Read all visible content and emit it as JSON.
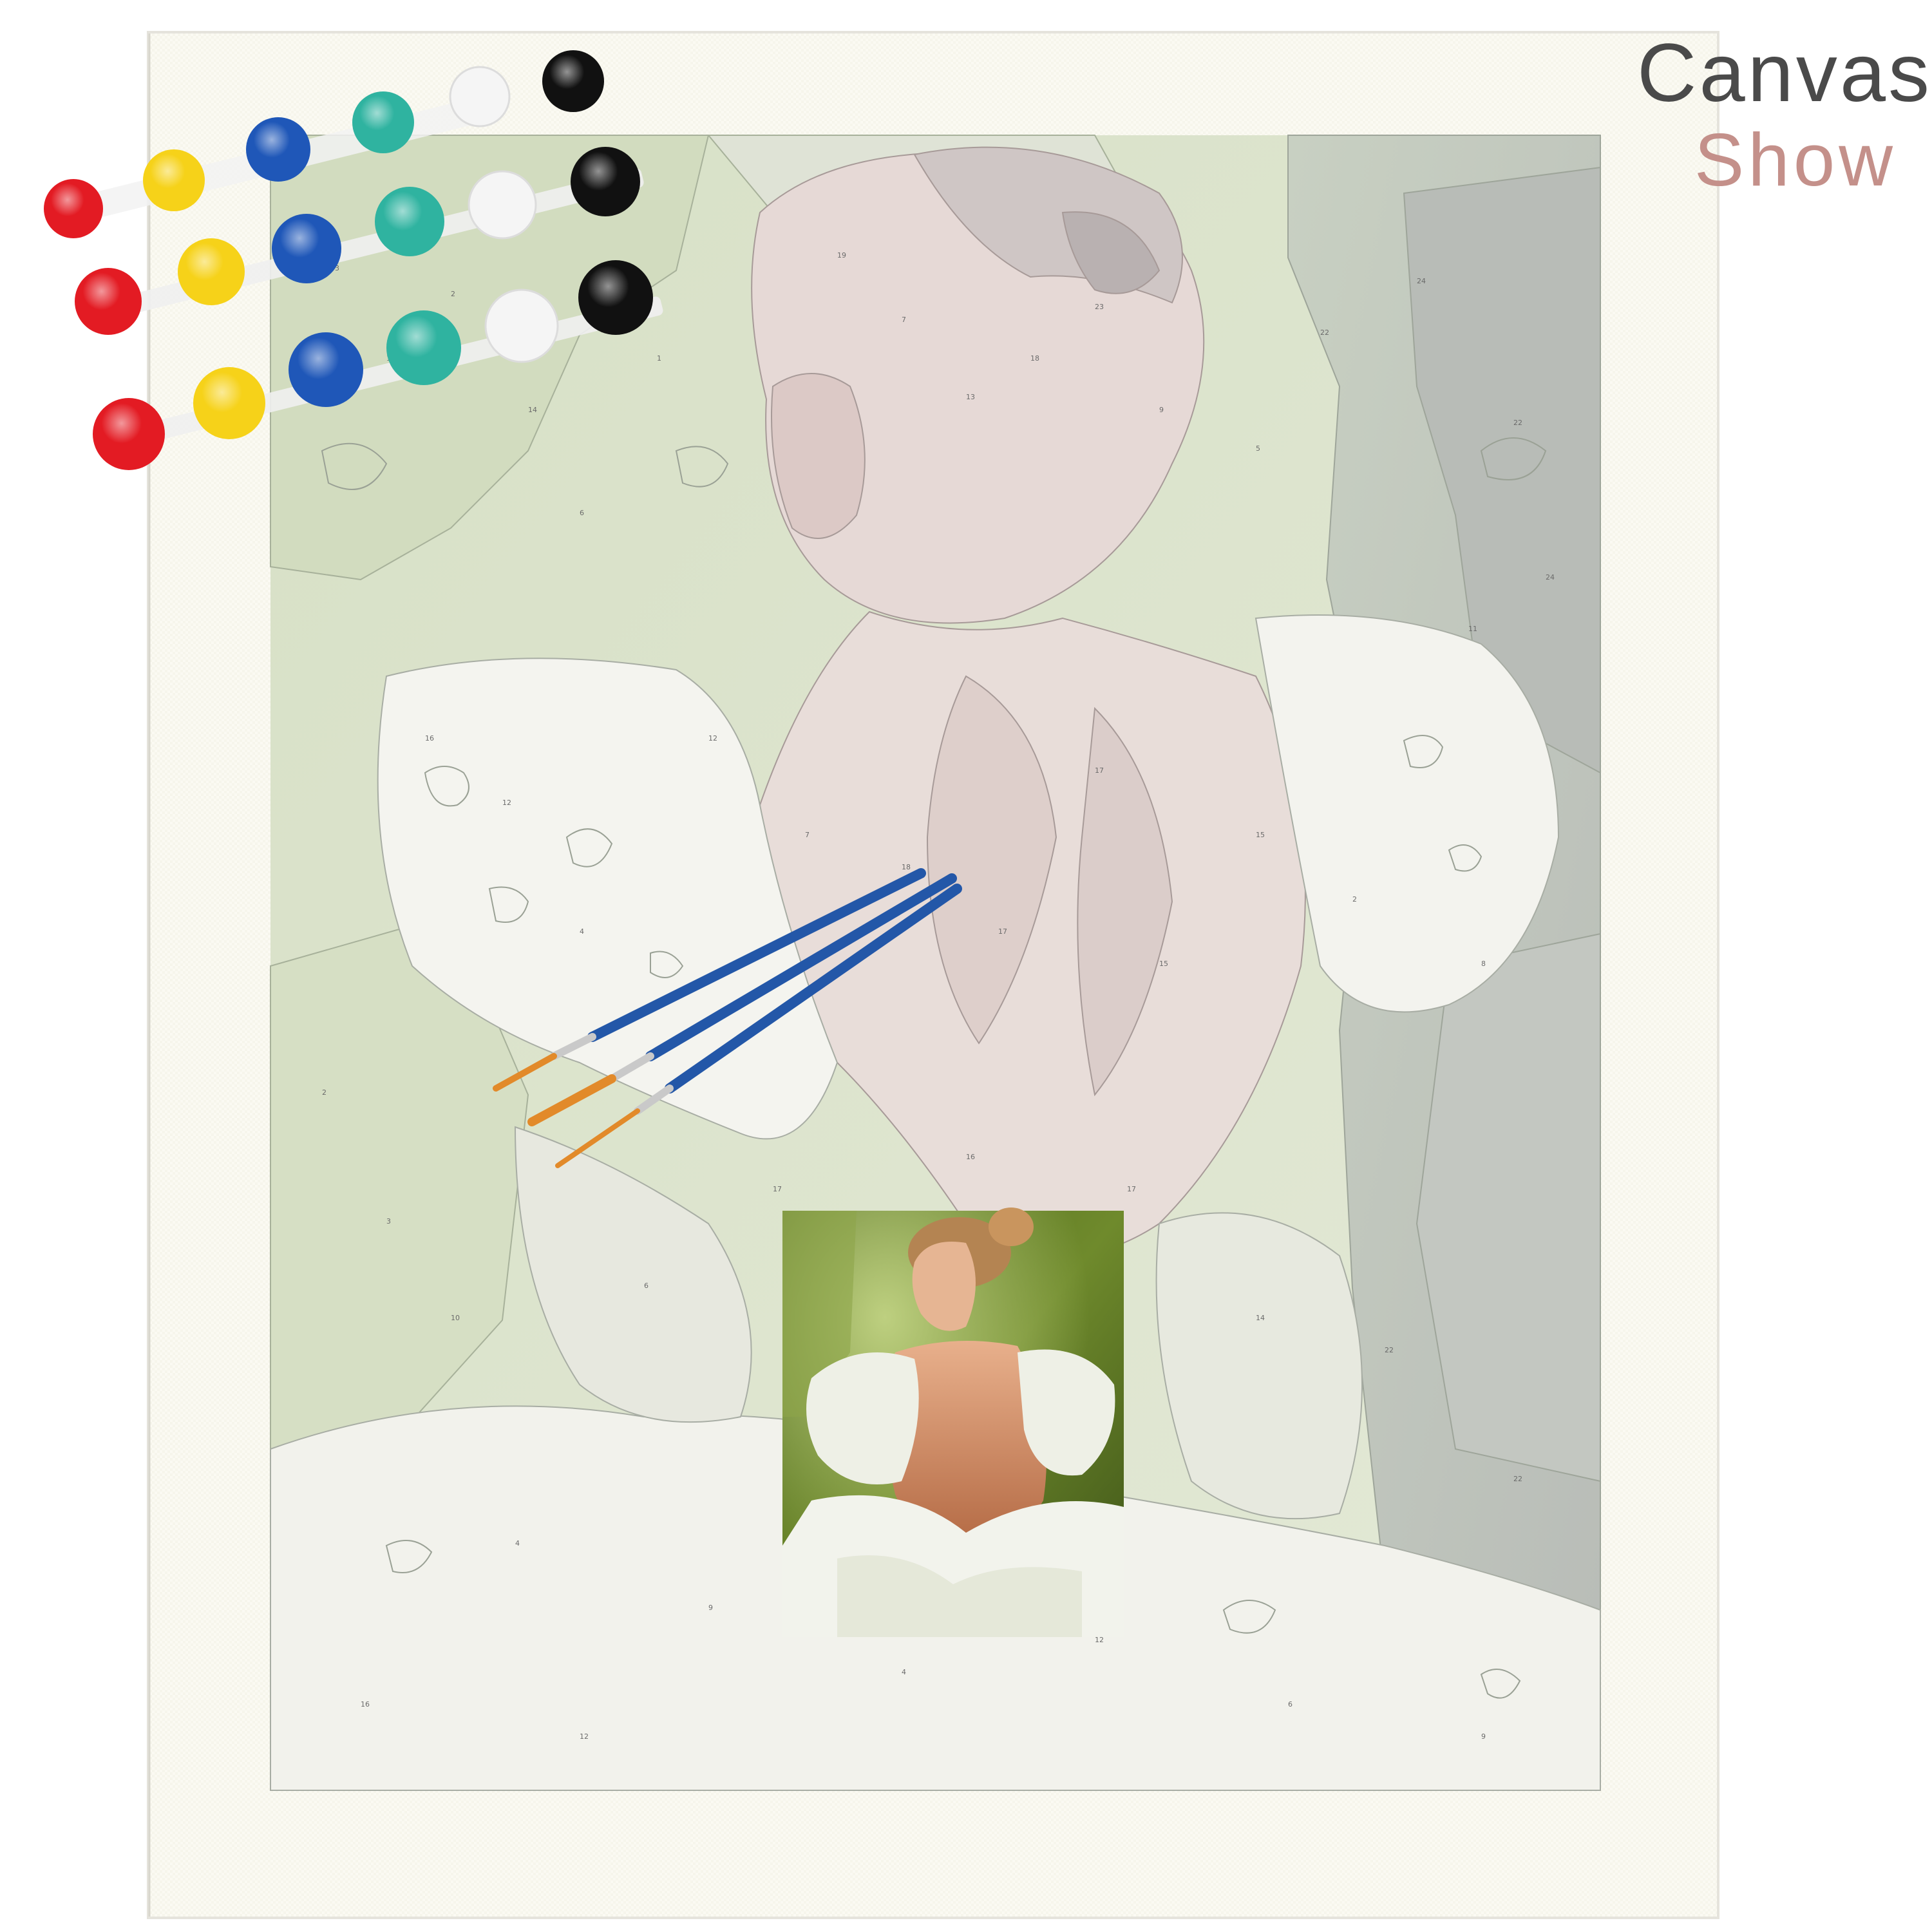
{
  "brand": {
    "line1": "Canvas",
    "line2": "Show",
    "line1_color": "#4a4a4a",
    "line2_color": "#c4908a"
  },
  "scene": {
    "description_items": [
      "canvas-board",
      "number-outline-painting",
      "paint-pots",
      "paint-brushes",
      "reference-thumbnail"
    ]
  },
  "paints": {
    "colors": [
      "#e31b23",
      "#f6d219",
      "#1f57b8",
      "#2fb3a0",
      "#f5f5f5",
      "#111111"
    ]
  },
  "brushes": {
    "handle_color": "#2357a8",
    "tip_color": "#e28a2a",
    "count": 3
  },
  "canvas": {
    "board_color": "#fbfaf3",
    "outline_palette": [
      "#dfe6cf",
      "#cfd9c0",
      "#e8dcd8",
      "#c9c9c9",
      "#f2f2ed",
      "#bcc3b8",
      "#dad0cf"
    ]
  }
}
